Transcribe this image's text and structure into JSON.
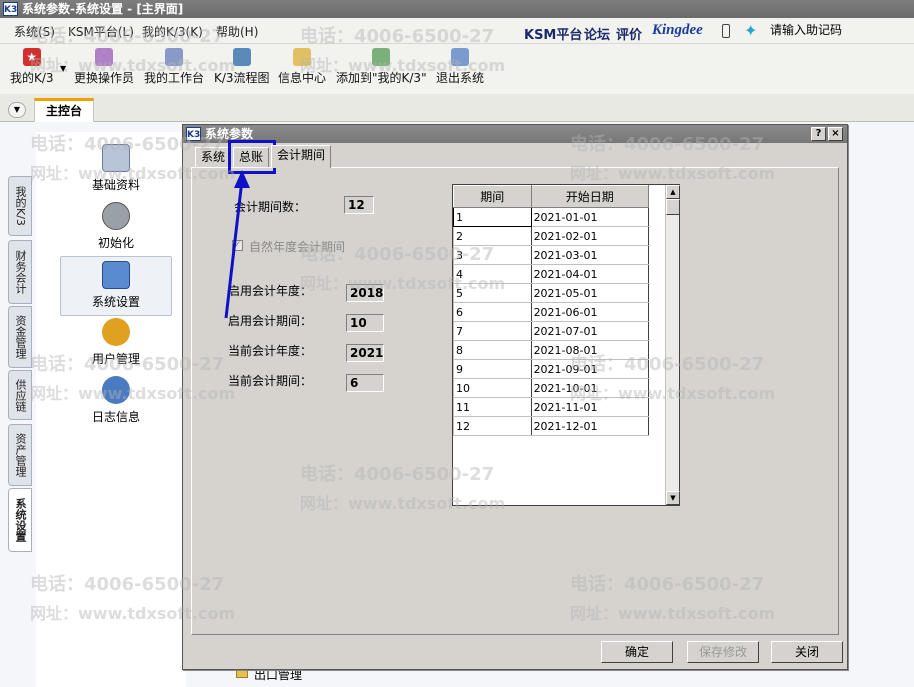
{
  "window": {
    "app_icon": "K3",
    "title": "系统参数-系统设置 - [主界面]"
  },
  "menubar": {
    "items": [
      "系统(S)",
      "KSM平台(L)",
      "我的K/3(K)",
      "帮助(H)"
    ],
    "links": [
      "KSM平台",
      "论坛",
      "评价"
    ],
    "brand": "Kingdee",
    "search_placeholder": "请输入助记码"
  },
  "toolbar": {
    "buttons": [
      {
        "label": "我的K/3",
        "icon": "star-icon",
        "color": "#d03030"
      },
      {
        "label": "更换操作员",
        "icon": "users-icon",
        "color": "#8a4aa8"
      },
      {
        "label": "我的工作台",
        "icon": "desk-icon",
        "color": "#5a6aa0"
      },
      {
        "label": "K/3流程图",
        "icon": "flow-icon",
        "color": "#2a6a9a"
      },
      {
        "label": "信息中心",
        "icon": "message-icon",
        "color": "#c09030"
      },
      {
        "label": "添加到\"我的K/3\"",
        "icon": "add-icon",
        "color": "#4a8a4a"
      },
      {
        "label": "退出系统",
        "icon": "exit-icon",
        "color": "#4a6ab0"
      }
    ]
  },
  "tabs": {
    "main": "主控台"
  },
  "vertical_tabs": [
    "我的K/3",
    "财务会计",
    "资金管理",
    "供应链",
    "资产管理",
    "系统设置"
  ],
  "left_nav": [
    {
      "label": "基础资料",
      "icon": "basic-data-icon"
    },
    {
      "label": "初始化",
      "icon": "init-icon"
    },
    {
      "label": "系统设置",
      "icon": "system-settings-icon"
    },
    {
      "label": "用户管理",
      "icon": "user-management-icon"
    },
    {
      "label": "日志信息",
      "icon": "log-icon"
    }
  ],
  "background_item": "出口管理",
  "dialog": {
    "app_icon": "K3",
    "title": "系统参数",
    "help_btn": "?",
    "close_btn": "×",
    "tabs": [
      "系统",
      "总账",
      "会计期间"
    ],
    "fields": {
      "period_count_label": "会计期间数：",
      "period_count": "12",
      "natural_year_label": "自然年度会计期间",
      "start_year_label": "启用会计年度：",
      "start_year": "2018",
      "start_period_label": "启用会计期间：",
      "start_period": "10",
      "current_year_label": "当前会计年度：",
      "current_year": "2021",
      "current_period_label": "当前会计期间：",
      "current_period": "6"
    },
    "grid": {
      "headers": [
        "期间",
        "开始日期"
      ],
      "rows": [
        [
          "1",
          "2021-01-01"
        ],
        [
          "2",
          "2021-02-01"
        ],
        [
          "3",
          "2021-03-01"
        ],
        [
          "4",
          "2021-04-01"
        ],
        [
          "5",
          "2021-05-01"
        ],
        [
          "6",
          "2021-06-01"
        ],
        [
          "7",
          "2021-07-01"
        ],
        [
          "8",
          "2021-08-01"
        ],
        [
          "9",
          "2021-09-01"
        ],
        [
          "10",
          "2021-10-01"
        ],
        [
          "11",
          "2021-11-01"
        ],
        [
          "12",
          "2021-12-01"
        ]
      ]
    },
    "buttons": {
      "ok": "确定",
      "save": "保存修改",
      "close": "关闭"
    }
  },
  "watermarks": {
    "phone": "电话：4006-6500-27",
    "site": "网址：www.tdxsoft.com"
  },
  "colors": {
    "annotation": "#1010c8",
    "accent_tab": "#f0a000"
  }
}
